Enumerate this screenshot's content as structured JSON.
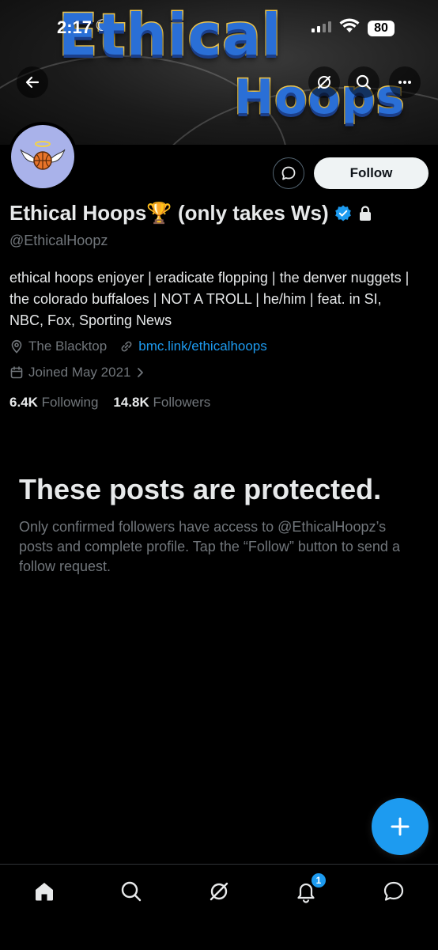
{
  "status_bar": {
    "time": "2:17",
    "battery": "80"
  },
  "banner": {
    "title_line1": "Ethical",
    "title_line2": "Hoops"
  },
  "header": {
    "back_icon": "back-arrow-icon",
    "grok_icon": "grok-icon",
    "search_icon": "search-icon",
    "more_icon": "more-icon"
  },
  "profile": {
    "display_name": "Ethical Hoops🏆 (only takes Ws)",
    "handle": "@EthicalHoopz",
    "bio": "ethical hoops enjoyer | eradicate flopping | the denver nuggets | the colorado buffaloes | NOT A TROLL | he/him | feat. in SI, NBC, Fox, Sporting News",
    "location": "The Blacktop",
    "website": "bmc.link/ethicalhoops",
    "joined": "Joined May 2021",
    "following_count": "6.4K",
    "following_label": "Following",
    "followers_count": "14.8K",
    "followers_label": "Followers"
  },
  "actions": {
    "follow_label": "Follow"
  },
  "protected": {
    "title": "These posts are protected.",
    "body": "Only confirmed followers have access to @EthicalHoopz’s posts and complete profile. Tap the “Follow” button to send a follow request."
  },
  "bottom_nav": {
    "notifications_badge": "1"
  },
  "colors": {
    "accent": "#1d9bf0",
    "background": "#000000",
    "secondary_text": "#71767b"
  }
}
